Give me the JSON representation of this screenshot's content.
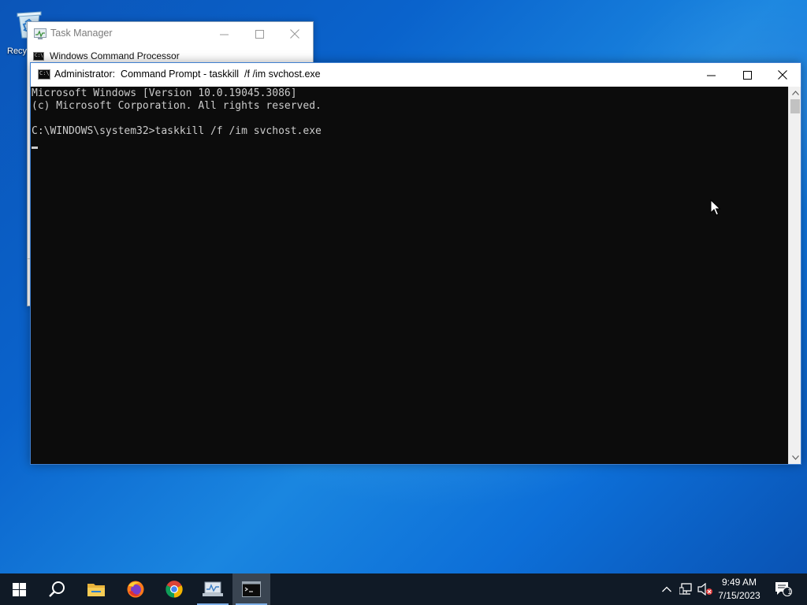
{
  "desktop": {
    "recycle_bin_label": "Recy"
  },
  "task_manager": {
    "title": "Task Manager",
    "process_row": "Windows Command Processor",
    "icon_text": "C:\\"
  },
  "cmd": {
    "title": "Administrator:  Command Prompt - taskkill  /f /im svchost.exe",
    "icon_text": "C:\\",
    "lines": [
      "Microsoft Windows [Version 10.0.19045.3086]",
      "(c) Microsoft Corporation. All rights reserved.",
      "",
      "C:\\WINDOWS\\system32>taskkill /f /im svchost.exe"
    ]
  },
  "taskbar": {
    "items": [
      "start-button",
      "search-button",
      "file-explorer",
      "firefox",
      "chrome",
      "network-tool",
      "command-prompt"
    ],
    "active_item": "command-prompt"
  },
  "tray": {
    "time": "9:49 AM",
    "date": "7/15/2023",
    "notification_count": "1"
  },
  "colors": {
    "console_bg": "#0c0c0c",
    "console_fg": "#cccccc",
    "taskbar_bg": "#101a26"
  }
}
